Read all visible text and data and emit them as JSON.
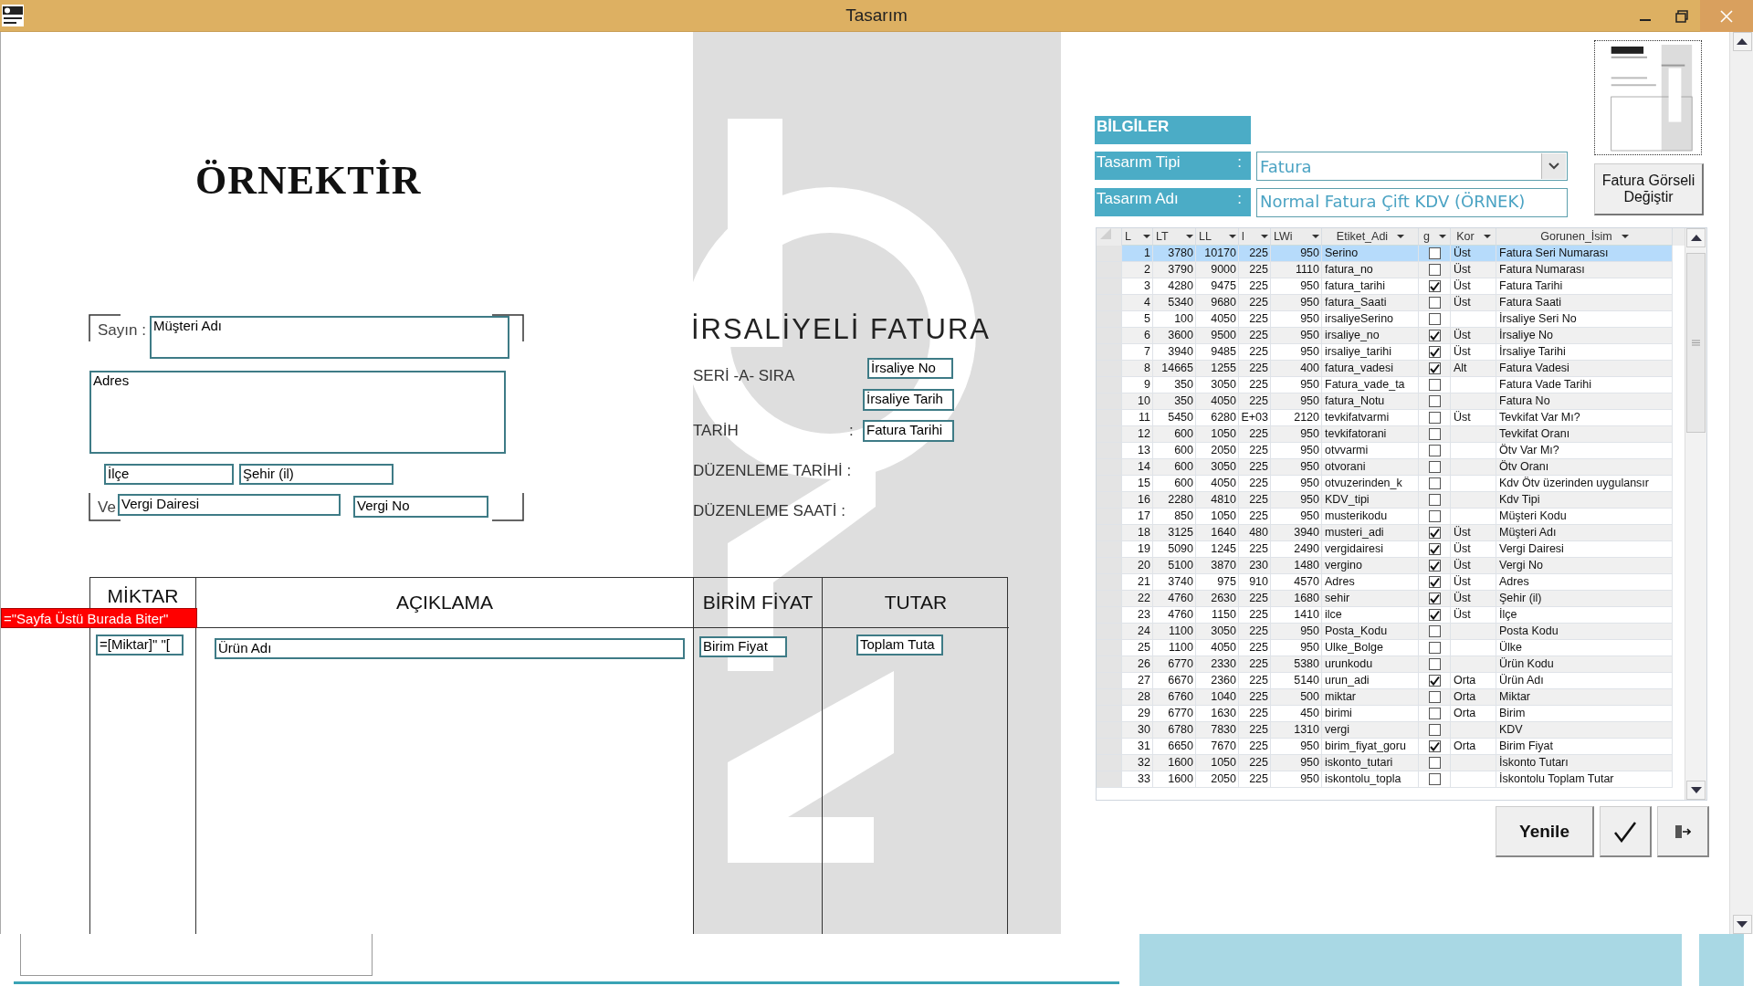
{
  "window": {
    "title": "Tasarım"
  },
  "design": {
    "labels": [
      {
        "kind": "title",
        "text": "ÖRNEKTİR"
      },
      {
        "kind": "small",
        "text": "Sayın :"
      },
      {
        "kind": "small",
        "text": "Ve"
      },
      {
        "kind": "heading",
        "text": "İRSALİYELİ FATURA"
      },
      {
        "kind": "caption",
        "text": "SERİ -A- SIRA"
      },
      {
        "kind": "caption",
        "text": "TARİH"
      },
      {
        "kind": "caption",
        "text": ":"
      },
      {
        "kind": "caption",
        "text": "DÜZENLEME TARİHİ :"
      },
      {
        "kind": "caption",
        "text": "DÜZENLEME SAATİ :"
      }
    ],
    "fields": [
      "Müşteri Adı",
      "Adres",
      "İlçe",
      "Şehir (il)",
      "Vergi Dairesi",
      "Vergi No",
      "İrsaliye No",
      "İrsaliye Tarih",
      "Fatura Tarihi",
      "=[Miktar]\" \"[",
      "Ürün Adı",
      "Birim Fiyat",
      "Toplam Tuta"
    ],
    "table_headers": [
      "MİKTAR",
      "AÇIKLAMA",
      "BİRİM FİYAT",
      "TUTAR"
    ],
    "section_marker": "=\"Sayfa Üstü Burada Biter\""
  },
  "info": {
    "header": "BİLGİLER",
    "type_label": "Tasarım Tipi",
    "type_value": "Fatura",
    "name_label": "Tasarım Adı",
    "name_value": "Normal Fatura Çift KDV (ÖRNEK)",
    "separator": ":",
    "image_button": "Fatura Görseli Değiştir"
  },
  "grid": {
    "columns": [
      "L",
      "LT",
      "LL",
      "l",
      "LWi",
      "Etiket_Adi",
      "g",
      "Kor",
      "Gorunen_İsim"
    ],
    "rows": [
      {
        "n": "1",
        "lt": "3780",
        "ll": "10170",
        "l": "225",
        "lw": "950",
        "etiket": "Serino",
        "g": false,
        "kor": "Üst",
        "gorunen": "Fatura Seri Numarası",
        "selected": true
      },
      {
        "n": "2",
        "lt": "3790",
        "ll": "9000",
        "l": "225",
        "lw": "1110",
        "etiket": "fatura_no",
        "g": false,
        "kor": "Üst",
        "gorunen": "Fatura Numarası",
        "selected": false
      },
      {
        "n": "3",
        "lt": "4280",
        "ll": "9475",
        "l": "225",
        "lw": "950",
        "etiket": "fatura_tarihi",
        "g": true,
        "kor": "Üst",
        "gorunen": "Fatura Tarihi",
        "selected": false
      },
      {
        "n": "4",
        "lt": "5340",
        "ll": "9680",
        "l": "225",
        "lw": "950",
        "etiket": "fatura_Saati",
        "g": false,
        "kor": "Üst",
        "gorunen": "Fatura Saati",
        "selected": false
      },
      {
        "n": "5",
        "lt": "100",
        "ll": "4050",
        "l": "225",
        "lw": "950",
        "etiket": "irsaliyeSerino",
        "g": false,
        "gorunen": "İrsaliye Seri No",
        "selected": false
      },
      {
        "n": "6",
        "lt": "3600",
        "ll": "9500",
        "l": "225",
        "lw": "950",
        "etiket": "irsaliye_no",
        "g": true,
        "kor": "Üst",
        "gorunen": "İrsaliye No",
        "selected": false
      },
      {
        "n": "7",
        "lt": "3940",
        "ll": "9485",
        "l": "225",
        "lw": "950",
        "etiket": "irsaliye_tarihi",
        "g": true,
        "kor": "Üst",
        "gorunen": "İrsaliye Tarihi",
        "selected": false
      },
      {
        "n": "8",
        "lt": "14665",
        "ll": "1255",
        "l": "225",
        "lw": "400",
        "etiket": "fatura_vadesi",
        "g": true,
        "kor": "Alt",
        "gorunen": "Fatura Vadesi",
        "selected": false
      },
      {
        "n": "9",
        "lt": "350",
        "ll": "3050",
        "l": "225",
        "lw": "950",
        "etiket": "Fatura_vade_ta",
        "g": false,
        "gorunen": "Fatura Vade Tarihi",
        "selected": false
      },
      {
        "n": "10",
        "lt": "350",
        "ll": "4050",
        "l": "225",
        "lw": "950",
        "etiket": "fatura_Notu",
        "g": false,
        "gorunen": "Fatura No",
        "selected": false
      },
      {
        "n": "11",
        "lt": "5450",
        "ll": "6280",
        "l": "E+03",
        "lw": "2120",
        "etiket": "tevkifatvarmi",
        "g": false,
        "kor": "Üst",
        "gorunen": "Tevkifat Var Mı?",
        "selected": false
      },
      {
        "n": "12",
        "lt": "600",
        "ll": "1050",
        "l": "225",
        "lw": "950",
        "etiket": "tevkifatorani",
        "g": false,
        "gorunen": "Tevkifat Oranı",
        "selected": false
      },
      {
        "n": "13",
        "lt": "600",
        "ll": "2050",
        "l": "225",
        "lw": "950",
        "etiket": "otvvarmi",
        "g": false,
        "gorunen": "Ötv Var Mı?",
        "selected": false
      },
      {
        "n": "14",
        "lt": "600",
        "ll": "3050",
        "l": "225",
        "lw": "950",
        "etiket": "otvorani",
        "g": false,
        "gorunen": "Ötv Oranı",
        "selected": false
      },
      {
        "n": "15",
        "lt": "600",
        "ll": "4050",
        "l": "225",
        "lw": "950",
        "etiket": "otvuzerinden_k",
        "g": false,
        "gorunen": "Kdv Ötv üzerinden uygulansır",
        "selected": false
      },
      {
        "n": "16",
        "lt": "2280",
        "ll": "4810",
        "l": "225",
        "lw": "950",
        "etiket": "KDV_tipi",
        "g": false,
        "gorunen": "Kdv Tipi",
        "selected": false
      },
      {
        "n": "17",
        "lt": "850",
        "ll": "1050",
        "l": "225",
        "lw": "950",
        "etiket": "musterikodu",
        "g": false,
        "gorunen": "Müşteri Kodu",
        "selected": false
      },
      {
        "n": "18",
        "lt": "3125",
        "ll": "1640",
        "l": "480",
        "lw": "3940",
        "etiket": "musteri_adi",
        "g": true,
        "kor": "Üst",
        "gorunen": "Müşteri Adı",
        "selected": false
      },
      {
        "n": "19",
        "lt": "5090",
        "ll": "1245",
        "l": "225",
        "lw": "2490",
        "etiket": "vergidairesi",
        "g": true,
        "kor": "Üst",
        "gorunen": "Vergi Dairesi",
        "selected": false
      },
      {
        "n": "20",
        "lt": "5100",
        "ll": "3870",
        "l": "230",
        "lw": "1480",
        "etiket": "vergino",
        "g": true,
        "kor": "Üst",
        "gorunen": "Vergi No",
        "selected": false
      },
      {
        "n": "21",
        "lt": "3740",
        "ll": "975",
        "l": "910",
        "lw": "4570",
        "etiket": "Adres",
        "g": true,
        "kor": "Üst",
        "gorunen": "Adres",
        "selected": false
      },
      {
        "n": "22",
        "lt": "4760",
        "ll": "2630",
        "l": "225",
        "lw": "1680",
        "etiket": "sehir",
        "g": true,
        "kor": "Üst",
        "gorunen": "Şehir (il)",
        "selected": false
      },
      {
        "n": "23",
        "lt": "4760",
        "ll": "1150",
        "l": "225",
        "lw": "1410",
        "etiket": "ilce",
        "g": true,
        "kor": "Üst",
        "gorunen": "İlçe",
        "selected": false
      },
      {
        "n": "24",
        "lt": "1100",
        "ll": "3050",
        "l": "225",
        "lw": "950",
        "etiket": "Posta_Kodu",
        "g": false,
        "gorunen": "Posta Kodu",
        "selected": false
      },
      {
        "n": "25",
        "lt": "1100",
        "ll": "4050",
        "l": "225",
        "lw": "950",
        "etiket": "Ulke_Bolge",
        "g": false,
        "gorunen": "Ülke",
        "selected": false
      },
      {
        "n": "26",
        "lt": "6770",
        "ll": "2330",
        "l": "225",
        "lw": "5380",
        "etiket": "urunkodu",
        "g": false,
        "gorunen": "Ürün Kodu",
        "selected": false
      },
      {
        "n": "27",
        "lt": "6670",
        "ll": "2360",
        "l": "225",
        "lw": "5140",
        "etiket": "urun_adi",
        "g": true,
        "kor": "Orta",
        "gorunen": "Ürün Adı",
        "selected": false
      },
      {
        "n": "28",
        "lt": "6760",
        "ll": "1040",
        "l": "225",
        "lw": "500",
        "etiket": "miktar",
        "g": false,
        "kor": "Orta",
        "gorunen": "Miktar",
        "selected": false
      },
      {
        "n": "29",
        "lt": "6770",
        "ll": "1630",
        "l": "225",
        "lw": "450",
        "etiket": "birimi",
        "g": false,
        "kor": "Orta",
        "gorunen": "Birim",
        "selected": false
      },
      {
        "n": "30",
        "lt": "6780",
        "ll": "7830",
        "l": "225",
        "lw": "1310",
        "etiket": "vergi",
        "g": false,
        "gorunen": "KDV",
        "selected": false
      },
      {
        "n": "31",
        "lt": "6650",
        "ll": "7670",
        "l": "225",
        "lw": "950",
        "etiket": "birim_fiyat_goru",
        "g": true,
        "kor": "Orta",
        "gorunen": "Birim Fiyat",
        "selected": false
      },
      {
        "n": "32",
        "lt": "1600",
        "ll": "1050",
        "l": "225",
        "lw": "950",
        "etiket": "iskonto_tutari",
        "g": false,
        "gorunen": "İskonto Tutarı",
        "selected": false
      },
      {
        "n": "33",
        "lt": "1600",
        "ll": "2050",
        "l": "225",
        "lw": "950",
        "etiket": "iskontolu_topla",
        "g": false,
        "gorunen": "İskontolu Toplam Tutar",
        "selected": false
      }
    ]
  },
  "buttons": {
    "refresh": "Yenile"
  }
}
